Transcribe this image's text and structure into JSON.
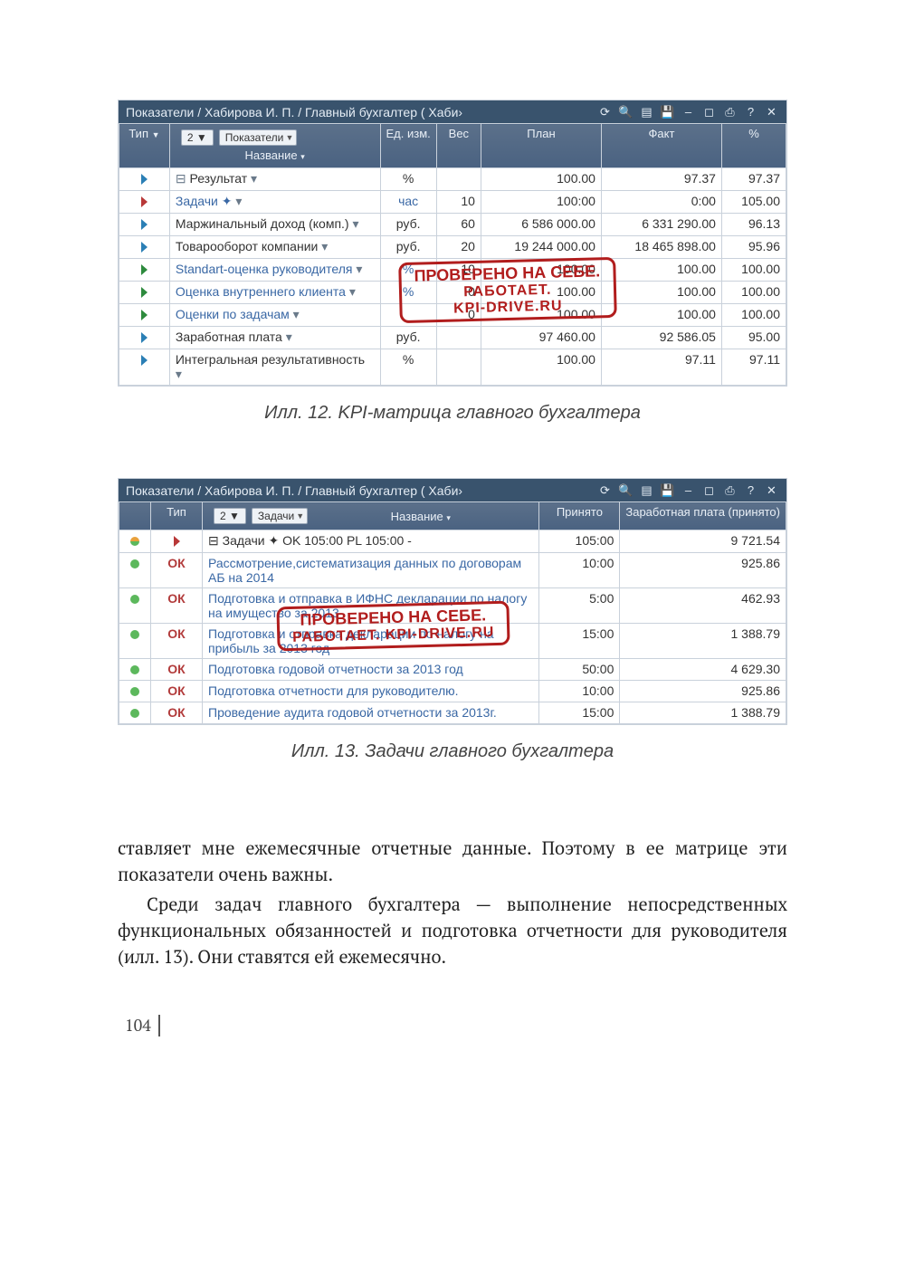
{
  "common": {
    "titlebar_text": "Показатели / Хабирова И. П. / Главный бухгалтер ( Хаби›",
    "stamp_line1": "ПРОВЕРЕНО НА СЕБЕ.",
    "stamp_line2a": "РАБОТАЕТ.",
    "stamp_line2b": "KPI-DRIVE.RU"
  },
  "fig12": {
    "caption": "Илл. 12. KPI-матрица главного бухгалтера",
    "columns": {
      "tip": "Тип",
      "name_hdr": "Название",
      "unit": "Ед.\nизм.",
      "weight": "Вес",
      "plan": "План",
      "fact": "Факт",
      "pct": "%"
    },
    "name_selector_count": "2",
    "name_selector_label": "Показатели",
    "rows": [
      {
        "tri": "bl",
        "tree": "⊟",
        "name": "Результат",
        "link": false,
        "unit": "%",
        "weight": "",
        "plan": "100.00",
        "fact": "97.37",
        "pct": "97.37"
      },
      {
        "tri": "rd",
        "tree": "",
        "name": "Задачи  ✦",
        "link": true,
        "unit": "час",
        "weight": "10",
        "plan": "100:00",
        "fact": "0:00",
        "pct": "105.00"
      },
      {
        "tri": "bl",
        "tree": "",
        "name": "Маржинальный доход (комп.)",
        "link": false,
        "unit": "руб.",
        "weight": "60",
        "plan": "6 586 000.00",
        "fact": "6 331 290.00",
        "pct": "96.13"
      },
      {
        "tri": "bl",
        "tree": "",
        "name": "Товарооборот компании",
        "link": false,
        "unit": "руб.",
        "weight": "20",
        "plan": "19 244 000.00",
        "fact": "18 465 898.00",
        "pct": "95.96"
      },
      {
        "tri": "gr",
        "tree": "",
        "name": "Standart-оценка руководителя",
        "link": true,
        "unit": "%",
        "weight": "10",
        "plan": "100.00",
        "fact": "100.00",
        "pct": "100.00"
      },
      {
        "tri": "gr",
        "tree": "",
        "name": "Оценка внутреннего клиента",
        "link": true,
        "unit": "%",
        "weight": "0",
        "plan": "100.00",
        "fact": "100.00",
        "pct": "100.00"
      },
      {
        "tri": "gr",
        "tree": "",
        "name": "Оценки по задачам",
        "link": true,
        "unit": "",
        "weight": "0",
        "plan": "100.00",
        "fact": "100.00",
        "pct": "100.00"
      },
      {
        "tri": "bl",
        "tree": "",
        "name": "Заработная плата",
        "link": false,
        "unit": "руб.",
        "weight": "",
        "plan": "97 460.00",
        "fact": "92 586.05",
        "pct": "95.00"
      },
      {
        "tri": "bl",
        "tree": "",
        "name": "Интегральная результативность",
        "link": false,
        "unit": "%",
        "weight": "",
        "plan": "100.00",
        "fact": "97.11",
        "pct": "97.11"
      }
    ]
  },
  "fig13": {
    "caption": "Илл. 13. Задачи главного бухгалтера",
    "columns": {
      "tip": "Тип",
      "name_hdr": "Название",
      "accepted": "Принято",
      "pay": "Заработная\nплата\n(принято)"
    },
    "name_selector_count": "2",
    "name_selector_label": "Задачи",
    "rows": [
      {
        "dot": "mix",
        "tri": "rd",
        "status": "",
        "name": "⊟  Задачи  ✦           OK   105:00   PL   105:00 -",
        "accepted": "105:00",
        "pay": "9 721.54"
      },
      {
        "dot": "gr",
        "tri": "",
        "status": "ОК",
        "name": "Рассмотрение,систематизация данных по договорам АБ на 2014",
        "accepted": "10:00",
        "pay": "925.86"
      },
      {
        "dot": "gr",
        "tri": "",
        "status": "ОК",
        "name": "Подготовка и отправка в ИФНС декларации по налогу на имущество за 2013",
        "accepted": "5:00",
        "pay": "462.93"
      },
      {
        "dot": "gr",
        "tri": "",
        "status": "ОК",
        "name": "Подготовка и отправка декларации по налогу на прибыль за 2013 год",
        "accepted": "15:00",
        "pay": "1 388.79"
      },
      {
        "dot": "gr",
        "tri": "",
        "status": "ОК",
        "name": "Подготовка годовой отчетности за 2013 год",
        "accepted": "50:00",
        "pay": "4 629.30"
      },
      {
        "dot": "gr",
        "tri": "",
        "status": "ОК",
        "name": "Подготовка отчетности для руководителю.",
        "accepted": "10:00",
        "pay": "925.86"
      },
      {
        "dot": "gr",
        "tri": "",
        "status": "ОК",
        "name": "Проведение аудита годовой отчетности за 2013г.",
        "accepted": "15:00",
        "pay": "1 388.79"
      }
    ]
  },
  "body": {
    "p1": "ставляет мне ежемесячные отчетные данные. Поэтому в ее матрице эти показатели очень важны.",
    "p2": "Среди задач главного бухгалтера — выполнение непосредственных функциональных обязанностей и подготовка отчетности для руководителя (илл. 13). Они ставятся ей ежемесячно."
  },
  "page_number": "104"
}
